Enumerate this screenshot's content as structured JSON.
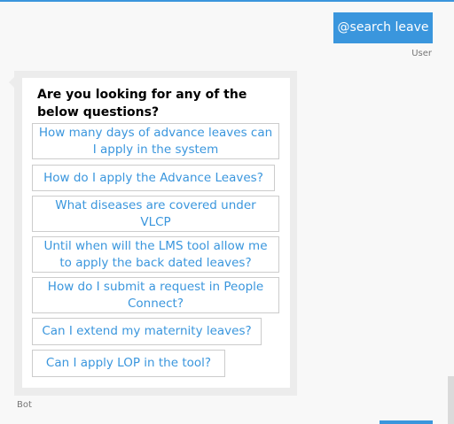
{
  "user_message": {
    "text": "@search leave",
    "sender_label": "User"
  },
  "bot_message": {
    "sender_label": "Bot",
    "title": "Are you looking for any of the below questions?",
    "options": [
      "How many days of advance leaves can I apply in the system",
      "How do I apply the Advance Leaves?",
      "What diseases are covered under VLCP",
      "Until when will the LMS tool allow me to apply the back dated leaves?",
      "How do I submit a request in People Connect?",
      "Can I extend my maternity leaves?",
      "Can I apply LOP in the tool?"
    ]
  },
  "colors": {
    "accent": "#3a96dd",
    "card_background": "#ffffff",
    "chat_background": "#f8f8f8",
    "option_border": "#cccccc"
  }
}
